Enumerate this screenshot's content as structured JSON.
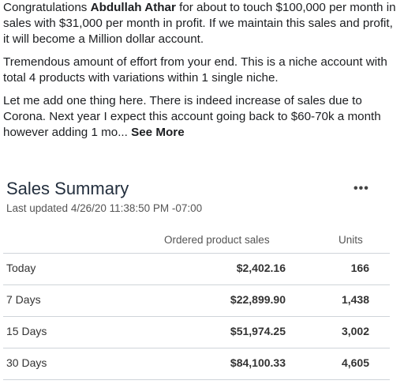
{
  "post": {
    "p1_pre": "Congratulations ",
    "p1_name": "Abdullah Athar",
    "p1_post": " for about to touch $100,000 per month in sales with $31,000 per month in profit. If we maintain this sales and profit, it will become a Million dollar account.",
    "p2": "Tremendous amount of effort from your end. This is a niche account with total 4 products with variations within 1 single niche.",
    "p3": "Let me add one thing here. There is indeed increase of sales due to Corona. Next year I expect this account going back to $60-70k a month however adding 1 mo... ",
    "see_more": "See More"
  },
  "sales_summary": {
    "title": "Sales Summary",
    "last_updated": "Last updated 4/26/20 11:38:50 PM -07:00",
    "more_icon": "•••",
    "columns": {
      "sales": "Ordered product sales",
      "units": "Units"
    },
    "rows": [
      {
        "period": "Today",
        "sales": "$2,402.16",
        "units": "166"
      },
      {
        "period": "7 Days",
        "sales": "$22,899.90",
        "units": "1,438"
      },
      {
        "period": "15 Days",
        "sales": "$51,974.25",
        "units": "3,002"
      },
      {
        "period": "30 Days",
        "sales": "$84,100.33",
        "units": "4,605"
      }
    ]
  }
}
